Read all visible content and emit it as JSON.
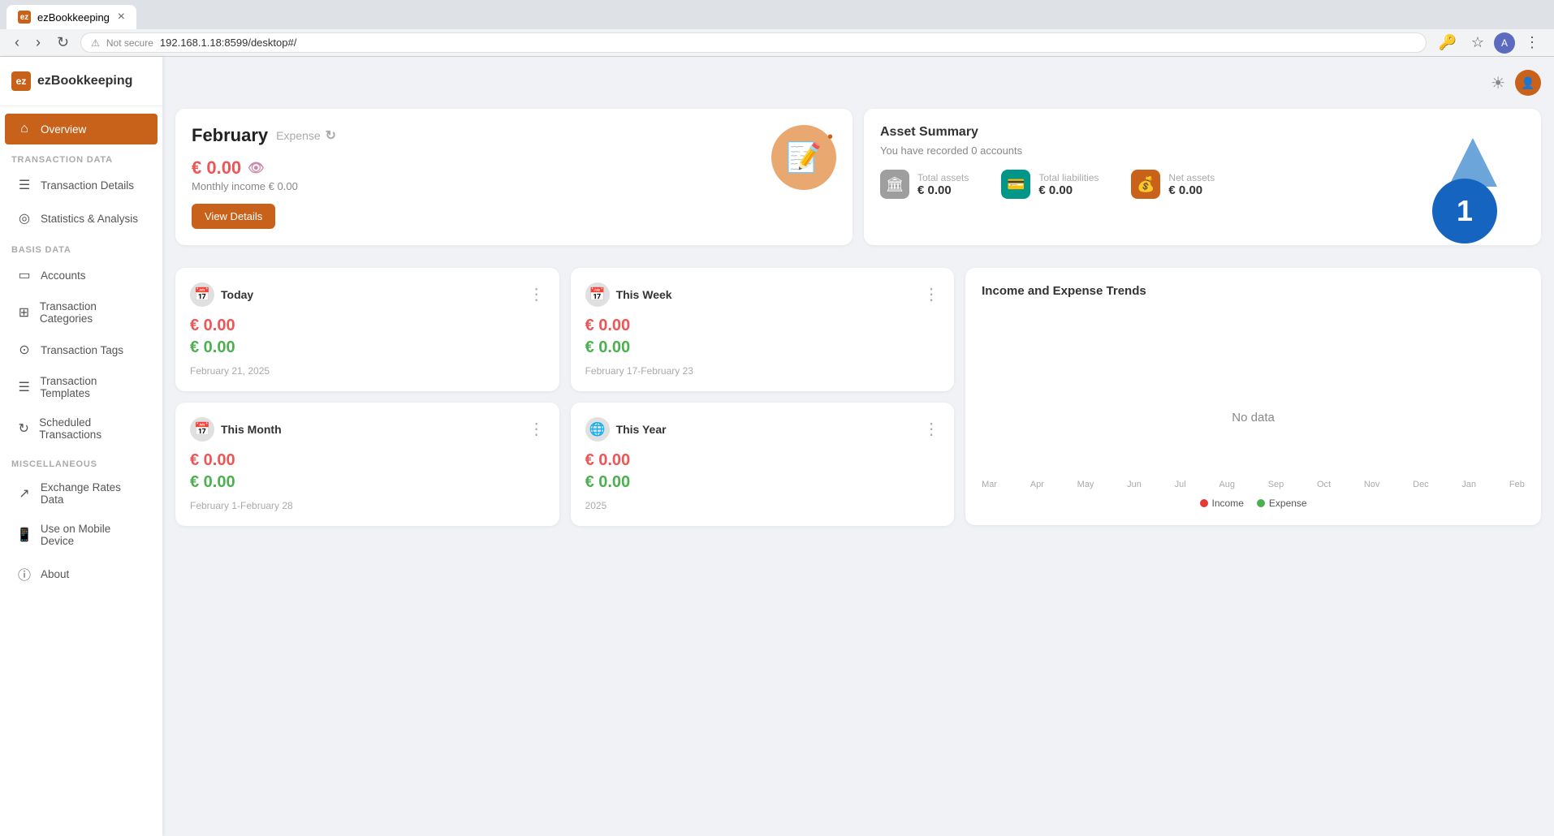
{
  "browser": {
    "tab_title": "ezBookkeeping",
    "tab_favicon": "ez",
    "address": "192.168.1.18:8599/desktop#/",
    "address_prefix": "Not secure"
  },
  "app": {
    "title": "ezBookkeeping",
    "logo_letter": "ez"
  },
  "sidebar": {
    "sections": [
      {
        "label": "",
        "items": [
          {
            "id": "overview",
            "label": "Overview",
            "icon": "⊞",
            "active": true
          }
        ]
      },
      {
        "label": "TRANSACTION DATA",
        "items": [
          {
            "id": "transaction-details",
            "label": "Transaction Details",
            "icon": "☰",
            "active": false
          },
          {
            "id": "statistics-analysis",
            "label": "Statistics & Analysis",
            "icon": "◎",
            "active": false
          }
        ]
      },
      {
        "label": "BASIS DATA",
        "items": [
          {
            "id": "accounts",
            "label": "Accounts",
            "icon": "▭",
            "active": false
          },
          {
            "id": "transaction-categories",
            "label": "Transaction Categories",
            "icon": "⊞",
            "active": false
          },
          {
            "id": "transaction-tags",
            "label": "Transaction Tags",
            "icon": "⊙",
            "active": false
          },
          {
            "id": "transaction-templates",
            "label": "Transaction Templates",
            "icon": "☰",
            "active": false
          },
          {
            "id": "scheduled-transactions",
            "label": "Scheduled Transactions",
            "icon": "🔁",
            "active": false
          }
        ]
      },
      {
        "label": "MISCELLANEOUS",
        "items": [
          {
            "id": "exchange-rates",
            "label": "Exchange Rates Data",
            "icon": "↗",
            "active": false
          },
          {
            "id": "mobile",
            "label": "Use on Mobile Device",
            "icon": "📱",
            "active": false
          },
          {
            "id": "about",
            "label": "About",
            "icon": "ⓘ",
            "active": false
          }
        ]
      }
    ]
  },
  "header": {
    "theme_icon": "☀",
    "avatar": "👤"
  },
  "feb_card": {
    "month": "February",
    "type": "Expense",
    "amount": "€ 0.00",
    "monthly_income_label": "Monthly income",
    "monthly_income": "€ 0.00",
    "btn_label": "View Details"
  },
  "asset_summary": {
    "title": "Asset Summary",
    "subtitle": "You have recorded 0 accounts",
    "total_assets_label": "Total assets",
    "total_assets": "€ 0.00",
    "total_liabilities_label": "Total liabilities",
    "total_liabilities": "€ 0.00",
    "net_assets_label": "Net assets",
    "net_assets": "€ 0.00"
  },
  "stat_cards": [
    {
      "id": "today",
      "title": "Today",
      "icon": "📅",
      "expense": "€ 0.00",
      "income": "€ 0.00",
      "date": "February 21, 2025"
    },
    {
      "id": "this-week",
      "title": "This Week",
      "icon": "📅",
      "expense": "€ 0.00",
      "income": "€ 0.00",
      "date": "February 17-February 23"
    },
    {
      "id": "this-month",
      "title": "This Month",
      "icon": "📅",
      "expense": "€ 0.00",
      "income": "€ 0.00",
      "date": "February 1-February 28"
    },
    {
      "id": "this-year",
      "title": "This Year",
      "icon": "🌐",
      "expense": "€ 0.00",
      "income": "€ 0.00",
      "date": "2025"
    }
  ],
  "trend_chart": {
    "title": "Income and Expense Trends",
    "no_data": "No data",
    "x_labels": [
      "Mar",
      "Apr",
      "May",
      "Jun",
      "Jul",
      "Aug",
      "Sep",
      "Oct",
      "Nov",
      "Dec",
      "Jan",
      "Feb"
    ],
    "legend_income": "Income",
    "legend_expense": "Expense"
  }
}
